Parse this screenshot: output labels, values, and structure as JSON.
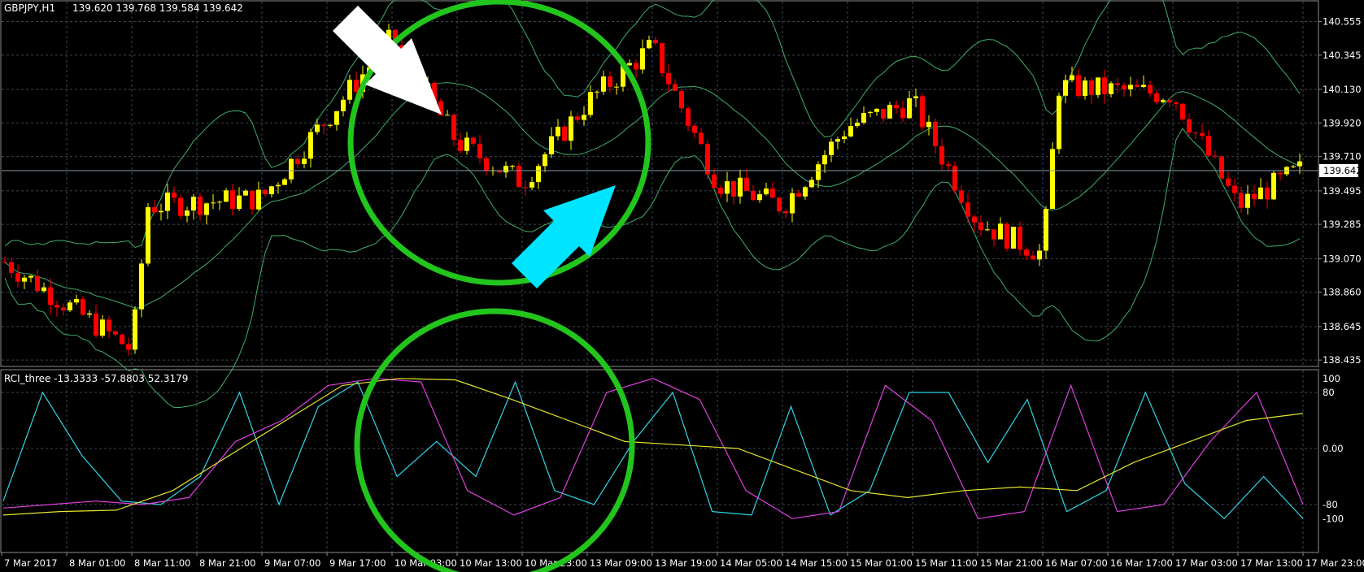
{
  "main_panel": {
    "header": {
      "symbol": "GBPJPY,H1",
      "ohlc": "139.620 139.768 139.584 139.642"
    },
    "current_price_label": "139.642",
    "price_ticks": [
      "140.555",
      "140.345",
      "140.130",
      "139.920",
      "139.710",
      "139.495",
      "139.285",
      "139.070",
      "138.860",
      "138.645",
      "138.435"
    ]
  },
  "sub_panel": {
    "header": "RCI_three -13.3333 -57.8803 52.3179",
    "level_ticks": [
      "100",
      "80",
      "0.00",
      "-80",
      "-100"
    ]
  },
  "time_axis": {
    "labels": [
      "7 Mar 2017",
      "8 Mar 01:00",
      "8 Mar 11:00",
      "8 Mar 21:00",
      "9 Mar 07:00",
      "9 Mar 17:00",
      "10 Mar 03:00",
      "10 Mar 13:00",
      "10 Mar 23:00",
      "13 Mar 09:00",
      "13 Mar 19:00",
      "14 Mar 05:00",
      "14 Mar 15:00",
      "15 Mar 01:00",
      "15 Mar 11:00",
      "15 Mar 21:00",
      "16 Mar 07:00",
      "16 Mar 17:00",
      "17 Mar 03:00",
      "17 Mar 13:00",
      "17 Mar 23:00"
    ]
  },
  "colors": {
    "background": "#000000",
    "grid": "#3c4650",
    "bull_candle": "#ffff00",
    "bear_candle": "#ff0000",
    "bands": "#3fae6a",
    "rci_short": "#2fd6e6",
    "rci_mid": "#e040e0",
    "rci_long": "#e6e62e",
    "annotation_circle": "#22c51c",
    "arrow_white": "#ffffff",
    "arrow_cyan": "#00e5ff"
  },
  "chart_data": [
    {
      "type": "candlestick",
      "title": "GBPJPY,H1",
      "ylim": [
        138.4,
        140.68
      ],
      "grid": true,
      "bands": "Bollinger-style upper/middle/lower envelopes",
      "key_closes": [
        {
          "time": "7 Mar 2017",
          "close": 139.05
        },
        {
          "time": "8 Mar 11:00",
          "close": 138.5
        },
        {
          "time": "8 Mar 11:00",
          "close": 139.4
        },
        {
          "time": "9 Mar 07:00",
          "close": 139.45
        },
        {
          "time": "10 Mar 03:00",
          "close": 140.45
        },
        {
          "time": "10 Mar 13:00",
          "close": 139.8
        },
        {
          "time": "10 Mar 23:00",
          "close": 139.55
        },
        {
          "time": "13 Mar 09:00",
          "close": 140.05
        },
        {
          "time": "13 Mar 19:00",
          "close": 140.4
        },
        {
          "time": "14 Mar 05:00",
          "close": 139.55
        },
        {
          "time": "14 Mar 15:00",
          "close": 139.4
        },
        {
          "time": "15 Mar 01:00",
          "close": 139.9
        },
        {
          "time": "15 Mar 11:00",
          "close": 140.05
        },
        {
          "time": "15 Mar 21:00",
          "close": 139.3
        },
        {
          "time": "16 Mar 07:00",
          "close": 139.1
        },
        {
          "time": "16 Mar 07:00",
          "close": 140.15
        },
        {
          "time": "17 Mar 03:00",
          "close": 140.1
        },
        {
          "time": "17 Mar 13:00",
          "close": 139.4
        },
        {
          "time": "17 Mar 23:00",
          "close": 139.642
        }
      ]
    },
    {
      "type": "line",
      "title": "RCI_three -13.3333 -57.8803 52.3179",
      "ylim": [
        -100,
        100
      ],
      "series": [
        {
          "color": "#2fd6e6",
          "values": [
            -75,
            80,
            -10,
            -75,
            -80,
            -40,
            80,
            -80,
            60,
            95,
            -40,
            10,
            -40,
            95,
            -60,
            -80,
            10,
            80,
            -90,
            -95,
            60,
            -95,
            -60,
            80,
            80,
            -20,
            70,
            -90,
            -60,
            80,
            -50,
            -100,
            -40,
            -100
          ]
        },
        {
          "color": "#e040e0",
          "values": [
            -85,
            -80,
            -75,
            -80,
            -70,
            10,
            40,
            90,
            100,
            95,
            -60,
            -95,
            -70,
            80,
            100,
            70,
            -60,
            -100,
            -90,
            90,
            40,
            -100,
            -90,
            90,
            -90,
            -80,
            10,
            80,
            -80
          ]
        },
        {
          "color": "#e6e62e",
          "values": [
            -95,
            -90,
            -88,
            -60,
            -10,
            40,
            90,
            100,
            98,
            70,
            40,
            10,
            5,
            0,
            -30,
            -60,
            -70,
            -60,
            -55,
            -60,
            -20,
            10,
            40,
            50
          ]
        }
      ]
    }
  ]
}
